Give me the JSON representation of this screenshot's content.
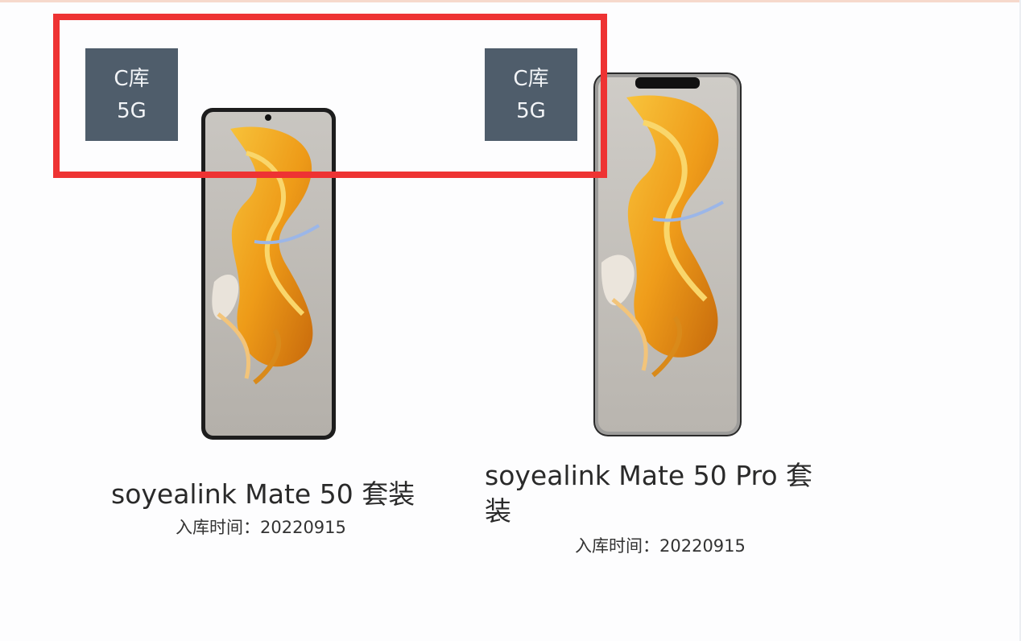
{
  "products": [
    {
      "badge_line1": "C库",
      "badge_line2": "5G",
      "title": "soyealink Mate 50 套装",
      "date_label": "入库时间：",
      "date_value": "20220915"
    },
    {
      "badge_line1": "C库",
      "badge_line2": "5G",
      "title": "soyealink Mate 50 Pro 套装",
      "date_label": "入库时间：",
      "date_value": "20220915"
    }
  ],
  "colors": {
    "highlight": "#ee3333",
    "badge_bg": "#4f5d6b",
    "badge_text": "#f2f4f7",
    "wallpaper_orange": "#f0a020"
  }
}
